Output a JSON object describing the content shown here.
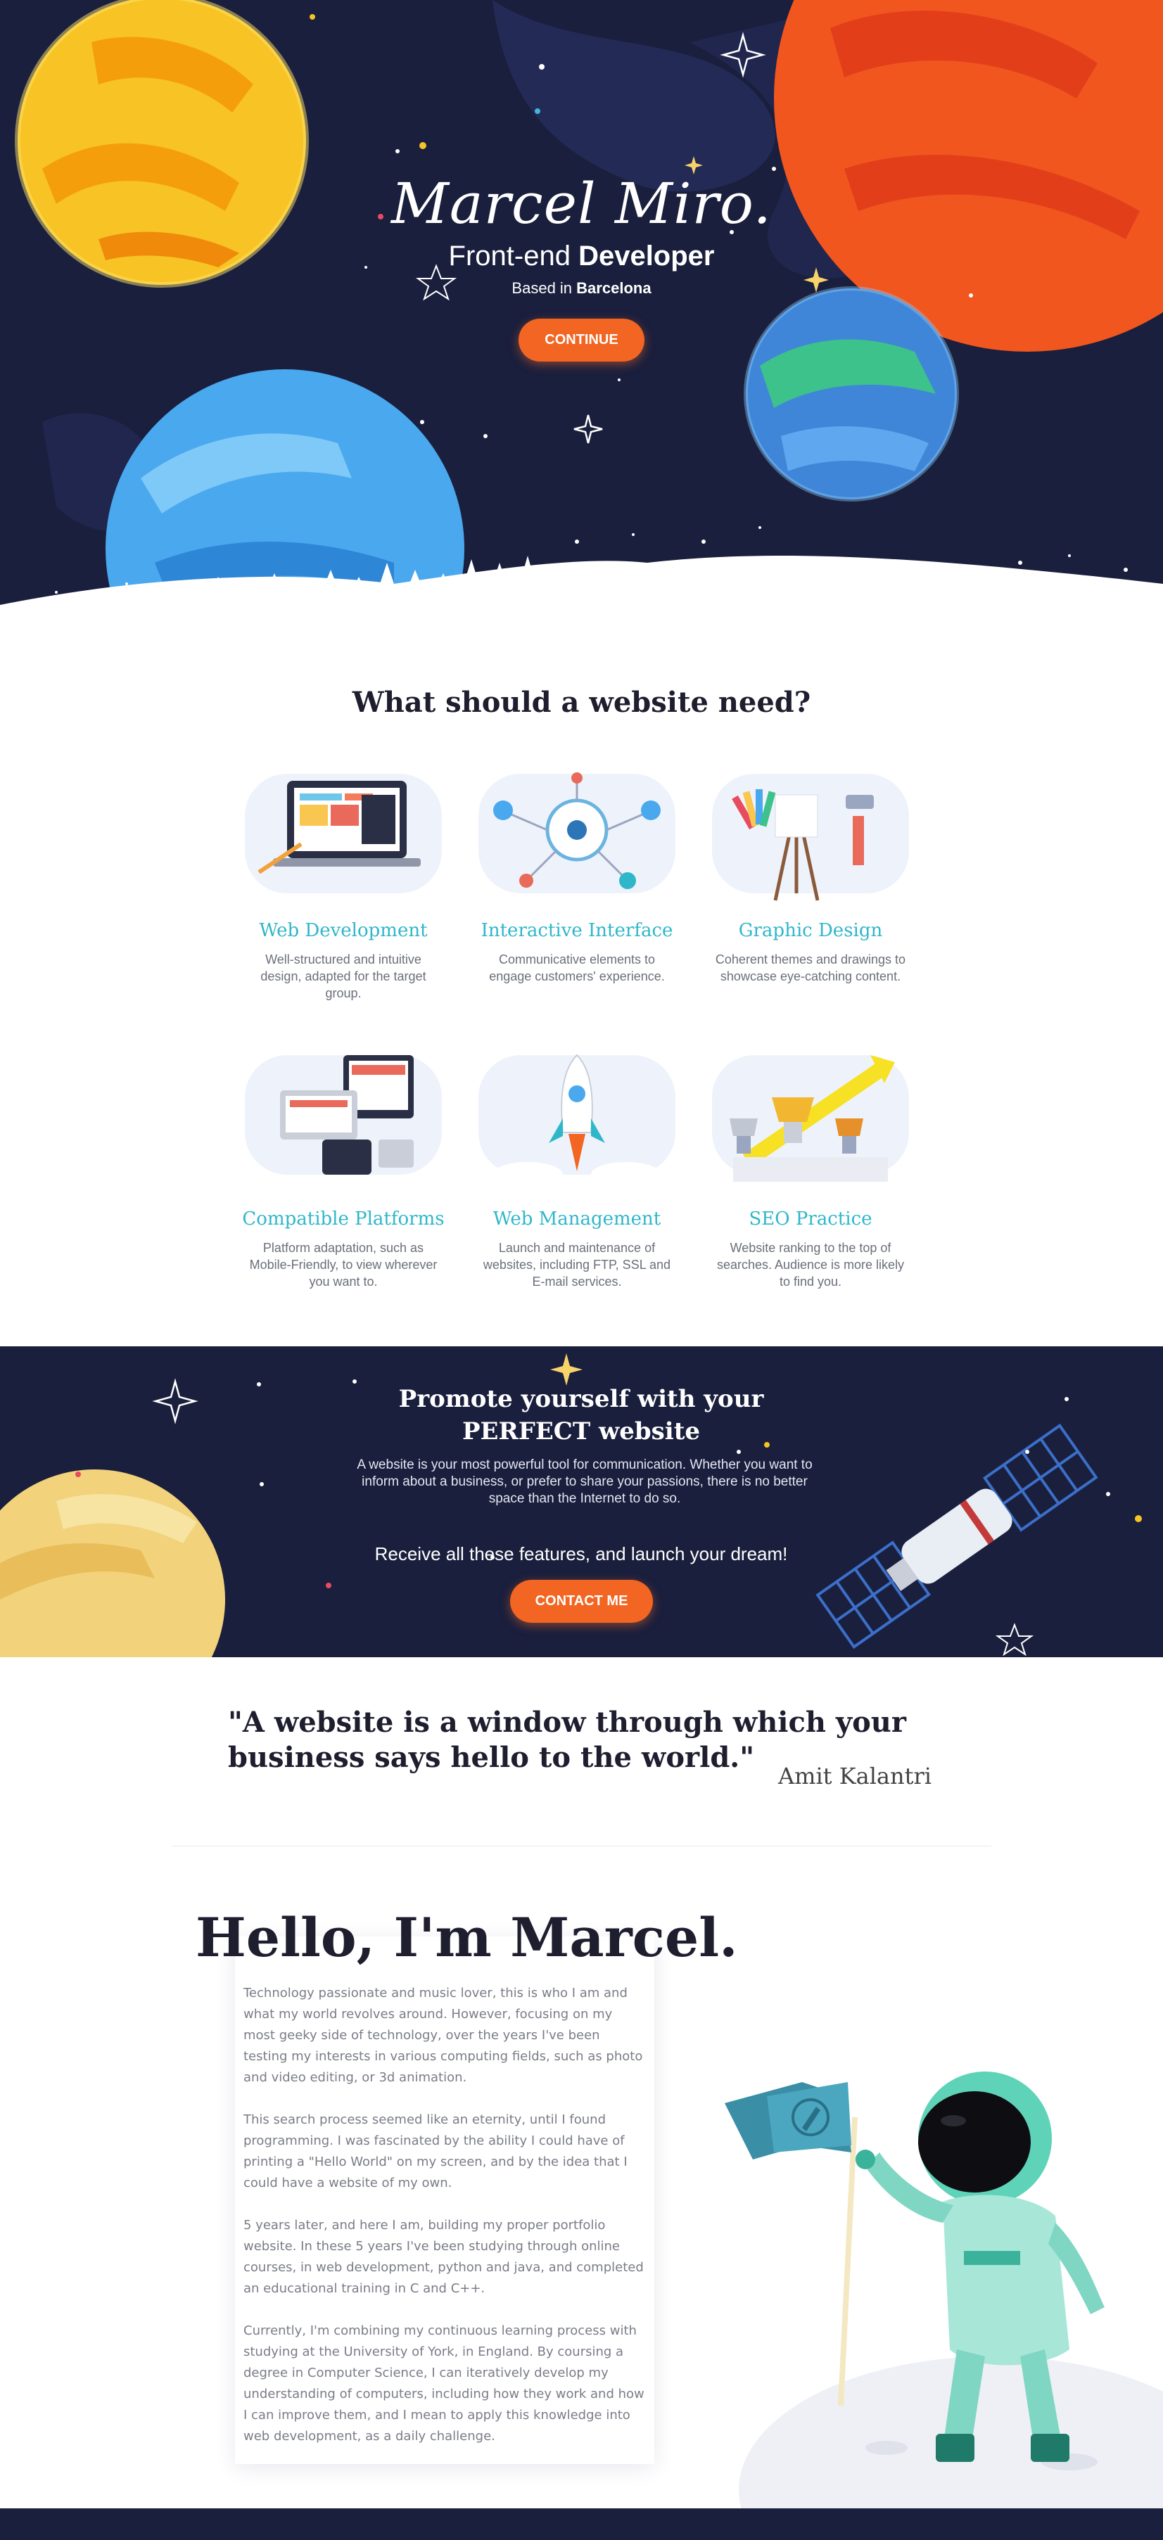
{
  "hero": {
    "name": "Marcel Miro.",
    "role_prefix": "Front-end",
    "role_bold": "Developer",
    "location_prefix": "Based in",
    "location_city": "Barcelona",
    "cta_label": "CONTINUE"
  },
  "features": {
    "heading": "What should a website need?",
    "items": [
      {
        "title": "Web Development",
        "desc": "Well-structured and intuitive design, adapted for the target group.",
        "icon": "laptop-design-icon"
      },
      {
        "title": "Interactive Interface",
        "desc": "Communicative elements to engage customers' experience.",
        "icon": "network-hub-icon"
      },
      {
        "title": "Graphic Design",
        "desc": "Coherent themes and drawings to showcase eye-catching content.",
        "icon": "easel-palette-icon"
      },
      {
        "title": "Compatible Platforms",
        "desc": "Platform adaptation, such as Mobile-Friendly, to view wherever you want to.",
        "icon": "multi-device-icon"
      },
      {
        "title": "Web Management",
        "desc": "Launch and maintenance of websites, including FTP, SSL and E-mail services.",
        "icon": "rocket-icon"
      },
      {
        "title": "SEO Practice",
        "desc": "Website ranking to the top of searches. Audience is more likely to find you.",
        "icon": "trophy-podium-icon"
      }
    ]
  },
  "promo": {
    "heading": "Promote yourself with your PERFECT website",
    "body": "A website is your most powerful tool for communication. Whether you want to inform about a business, or prefer to share your passions, there is no better space than the Internet to do so.",
    "tagline": "Receive all these features, and launch your dream!",
    "cta_label": "CONTACT ME"
  },
  "quote": {
    "text": "\"A website is a window through which your business says hello to the world.\"",
    "author": "Amit Kalantri"
  },
  "about": {
    "title": "Hello, I'm Marcel.",
    "paragraphs": [
      "Technology passionate and music lover, this is who I am and what my world revolves around. However, focusing on my most geeky side of technology, over the years I've been testing my interests in various computing fields, such as photo and video editing, or 3d animation.",
      "This search process seemed like an eternity, until I found programming. I was fascinated by the ability I could have of printing a \"Hello World\" on my screen, and by the idea that I could have a website of my own.",
      "5 years later, and here I am, building my proper portfolio website. In these 5 years I've been studying through online courses, in web development, python and java, and completed an educational training in C and C++.",
      "Currently, I'm combining my continuous learning process with studying at the University of York, in England. By coursing a degree in Computer Science, I can iteratively develop my understanding of computers, including how they work and how I can improve them, and I mean to apply this knowledge into web development, as a daily challenge."
    ]
  },
  "colors": {
    "navy": "#1a1f3d",
    "accent_orange": "#f26522",
    "teal_title": "#2fb7c9"
  }
}
